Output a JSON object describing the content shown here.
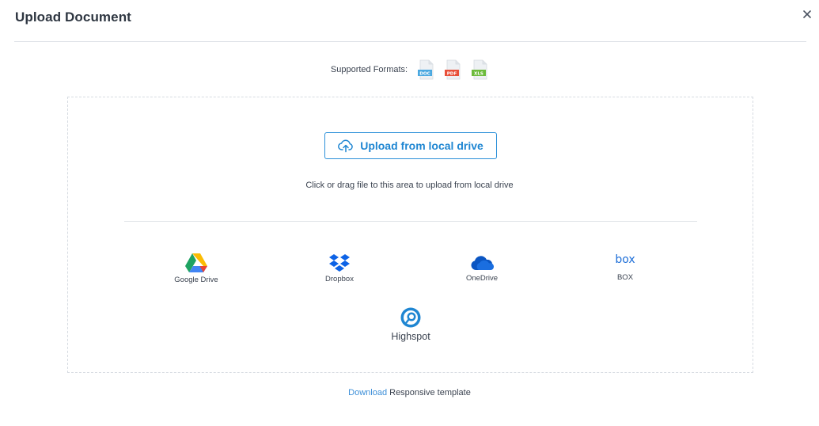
{
  "dialog": {
    "title": "Upload Document",
    "close_icon": "close-icon"
  },
  "formats": {
    "label": "Supported Formats:",
    "items": [
      {
        "name": "DOC",
        "color": "#4aa8e0",
        "icon": "doc-file-icon"
      },
      {
        "name": "PDF",
        "color": "#e8503a",
        "icon": "pdf-file-icon"
      },
      {
        "name": "XLS",
        "color": "#6cbb3c",
        "icon": "xls-file-icon"
      }
    ]
  },
  "upload": {
    "button_label": "Upload from local drive",
    "button_icon": "cloud-upload-icon",
    "hint": "Click or drag file to this area to upload from local drive",
    "accent_color": "#1f86d2"
  },
  "services": [
    {
      "label": "Google Drive",
      "icon": "google-drive-icon"
    },
    {
      "label": "Dropbox",
      "icon": "dropbox-icon"
    },
    {
      "label": "OneDrive",
      "icon": "onedrive-icon"
    },
    {
      "label": "BOX",
      "icon": "box-icon"
    },
    {
      "label": "Highspot",
      "icon": "highspot-icon"
    }
  ],
  "footer": {
    "link_label": "Download",
    "text": " Responsive template"
  }
}
